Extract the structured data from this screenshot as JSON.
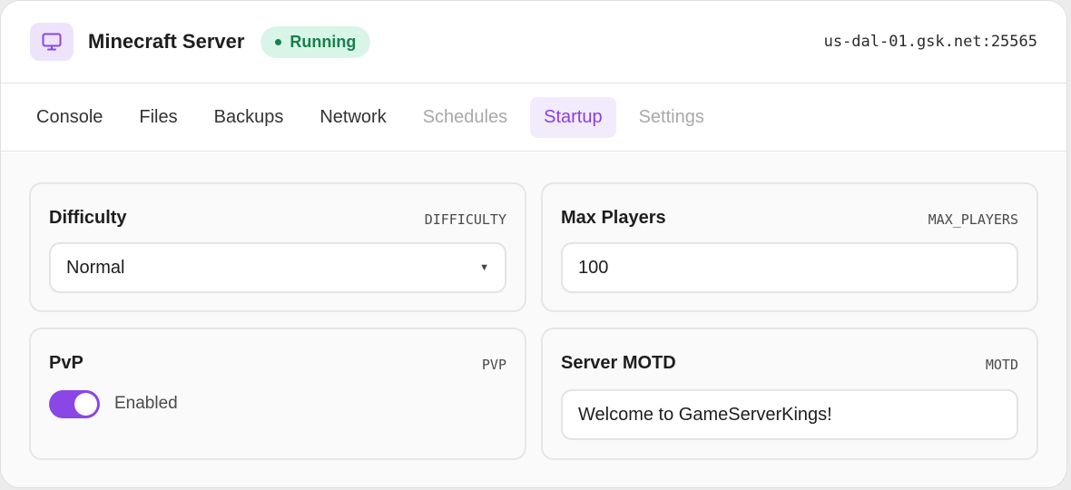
{
  "header": {
    "title": "Minecraft Server",
    "status": "Running",
    "address": "us-dal-01.gsk.net:25565",
    "icon": "monitor-icon"
  },
  "colors": {
    "accent": "#8b46e6",
    "status_bg": "#d9f5e8",
    "status_text": "#17804c"
  },
  "tabs": [
    {
      "label": "Console",
      "state": "normal"
    },
    {
      "label": "Files",
      "state": "normal"
    },
    {
      "label": "Backups",
      "state": "normal"
    },
    {
      "label": "Network",
      "state": "normal"
    },
    {
      "label": "Schedules",
      "state": "muted"
    },
    {
      "label": "Startup",
      "state": "active"
    },
    {
      "label": "Settings",
      "state": "muted"
    }
  ],
  "cards": {
    "difficulty": {
      "label": "Difficulty",
      "env": "DIFFICULTY",
      "value": "Normal"
    },
    "max_players": {
      "label": "Max Players",
      "env": "MAX_PLAYERS",
      "value": "100"
    },
    "pvp": {
      "label": "PvP",
      "env": "PVP",
      "state_text": "Enabled",
      "enabled": true
    },
    "motd": {
      "label": "Server MOTD",
      "env": "MOTD",
      "value": "Welcome to GameServerKings!"
    }
  }
}
